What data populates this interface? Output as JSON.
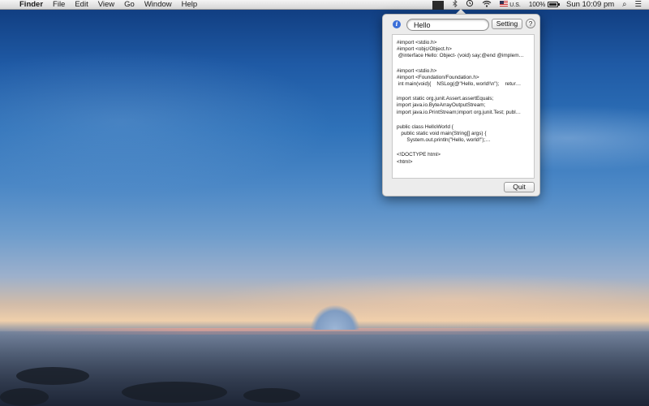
{
  "menubar": {
    "apple_glyph": "",
    "app_name": "Finder",
    "items": [
      "File",
      "Edit",
      "View",
      "Go",
      "Window",
      "Help"
    ],
    "status": {
      "app_icon_glyph": "",
      "input_source": "U.S.",
      "battery_percent": "100%",
      "clock": "Sun 10:09 pm",
      "search_glyph": "⌕",
      "list_glyph": "☰"
    }
  },
  "popover": {
    "search": {
      "value": "Hello",
      "placeholder": ""
    },
    "info_glyph": "i",
    "setting_label": "Setting",
    "help_label": "?",
    "quit_label": "Quit",
    "snippets": [
      {
        "lines": [
          "#import <stdio.h>",
          "#import <objc/Object.h>",
          " @interface Hello: Object- (void) say;@end @implem…"
        ]
      },
      {
        "lines": [
          "#import <stdio.h>",
          "#import <Foundation/Foundation.h>",
          " int main(void){    NSLog(@\"Hello, world!\\n\");    retur…"
        ]
      },
      {
        "lines": [
          "import static org.junit.Assert.assertEquals;",
          "import java.io.ByteArrayOutputStream;",
          "import java.io.PrintStream;import org.junit.Test; publ…"
        ]
      },
      {
        "lines": [
          "public class HelloWorld {",
          "   public static void main(String[] args) {",
          "       System.out.println(\"Hello, world!\");…"
        ]
      },
      {
        "lines": [
          "<!DOCTYPE html>",
          "<html>"
        ]
      }
    ]
  }
}
